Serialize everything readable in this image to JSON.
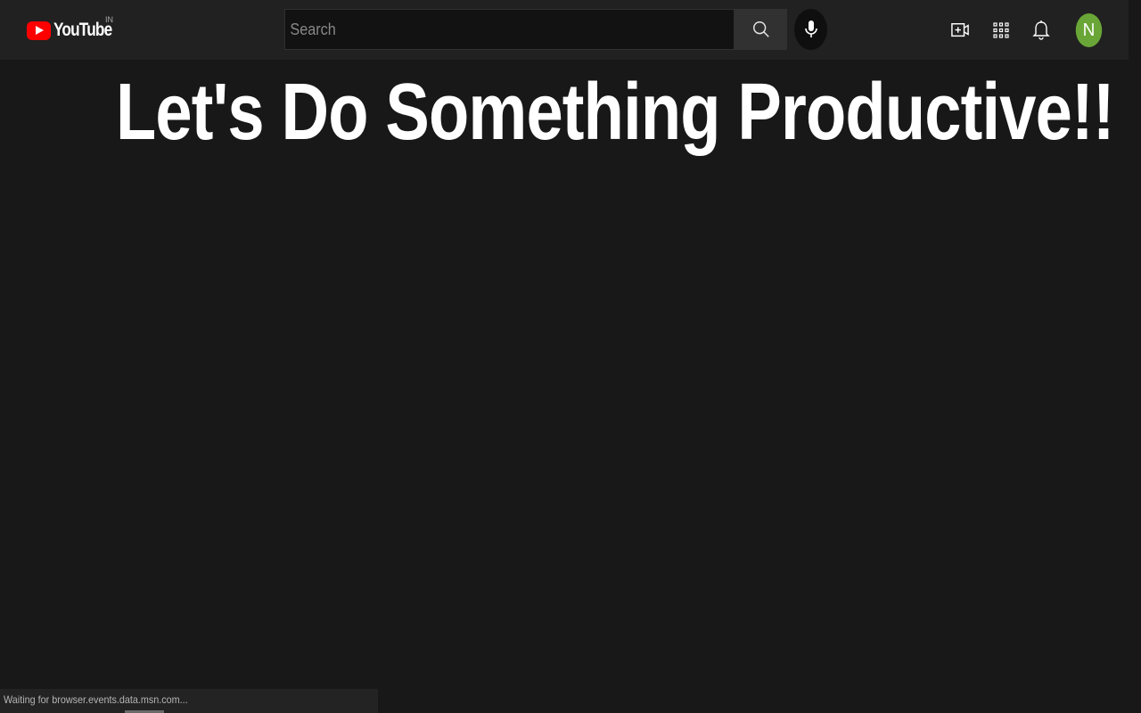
{
  "header": {
    "logo_text": "YouTube",
    "region_code": "IN",
    "search": {
      "placeholder": "Search",
      "value": ""
    },
    "icons": {
      "search": "search-icon",
      "mic": "mic-icon",
      "create": "video-plus-icon",
      "apps": "apps-grid-icon",
      "notifications": "bell-icon"
    },
    "avatar_letter": "N"
  },
  "main": {
    "headline": "Let's Do Something Productive!!"
  },
  "status_bar": {
    "text": "Waiting for browser.events.data.msn.com..."
  },
  "colors": {
    "background": "#181818",
    "topbar": "#212121",
    "brand_red": "#ff0000",
    "avatar": "#6aa637"
  }
}
